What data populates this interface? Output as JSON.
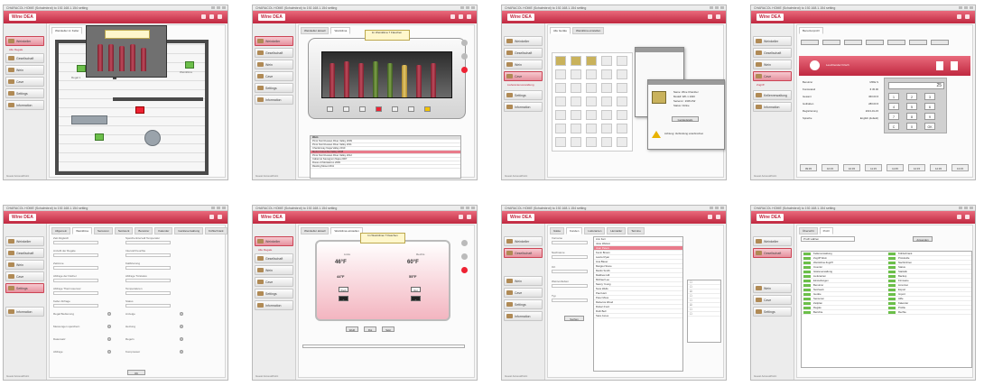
{
  "app": {
    "window_title": "CHARACOL HOME (Schalmbrot) to 192.168.1.154 setting",
    "logo": "Wine DEA",
    "footer": "Guest\nAccessPoint"
  },
  "sidebar_labels": [
    "Weinkeller",
    "Gesellschaft",
    "Wein",
    "Cave",
    "Settings",
    "Kellerverwaltung",
    "Information"
  ],
  "sidebar_sub": [
    "Alle Regale",
    "Lieferantenverwaltung",
    "Zugriff"
  ],
  "shots": [
    {
      "name": "floor-plan",
      "tab": "Weinkeller im Keller",
      "labels": [
        "Kühlschrank A",
        "Regal 1",
        "Regal 2",
        "Weinklima",
        "Tür"
      ]
    },
    {
      "name": "wine-rack",
      "tabs": [
        "Weinkeller aktuell",
        "Weinklima"
      ],
      "status": "Im Weinklima\n7 Flaschen",
      "table_headers": [
        "Wein",
        "Jahr",
        "Platz",
        "Zustand"
      ],
      "rows": [
        "Pinot Noir Russian River Valley 2009",
        "Pinot Noir Russian River Valley 2011",
        "Chardonnay Napa Valley 2010",
        "Merlot Columbia Valley 2008",
        "Pinot Noir Russian River Valley 2012",
        "Cabernet Sauvignon Napa 2007",
        "Rosso di Montalcino 2009",
        "Riesling Mosel 2011"
      ]
    },
    {
      "name": "device-overview",
      "tabs": [
        "Alle Geräte",
        "Weinklima einstellen"
      ],
      "dialog_title": "Gerätedetails",
      "dialog_fields": [
        "Name: Wine Chamber",
        "Modell: WK-1 1020",
        "Seriennr.: 2345-FW",
        "Status: Online"
      ],
      "alert": "Achtung: Verbindung unterbrochen"
    },
    {
      "name": "user-profile",
      "tab": "Benutzerprofil",
      "user": "Leuchtender Frisch",
      "pin_display": "25",
      "fields": [
        "Benutzer",
        "Kontostand",
        "Gesamt",
        "Guthaben",
        "Registrierung",
        "Sprache"
      ],
      "values": [
        "MIKE S",
        "€ 45.00",
        "360.00 €",
        "280.00 €",
        "2013-01-15",
        "English (default)"
      ],
      "time_buttons": [
        "09:45",
        "10:15",
        "10:45",
        "11:15",
        "11:45",
        "12:15",
        "12:45",
        "13:15"
      ]
    },
    {
      "name": "settings-form",
      "tabs": [
        "Allgemein",
        "Weinklima",
        "Sensoren",
        "Netzwerk",
        "Benutzer",
        "Kalender",
        "Geräteverwaltung",
        "Kühlschrank"
      ],
      "left_labels": [
        "Zeit Abgleich",
        "Anzahl der Regale",
        "Zeitzone",
        "Abfrage der Fächer",
        "Abfrage Thermosensor",
        "Keller Abfrage",
        "Regal Bedienung",
        "Messungen speichern",
        "Datensatz",
        "Abfrage"
      ],
      "right_labels": [
        "Speicherintervall Temperatur",
        "Intervall Feuchte",
        "Kalibrierung",
        "Abfrage Türstatus",
        "Temperaturen",
        "Status",
        "Anzeige",
        "Heizung",
        "Regeln",
        "Kompressor"
      ]
    },
    {
      "name": "thermostat",
      "tabs": [
        "Weinkeller aktuell",
        "Weinklima einstellen"
      ],
      "status": "Im Weinklima\n7 Flaschen",
      "left_title": "Links",
      "right_title": "Rechts",
      "left_temp": "46°F",
      "right_temp": "60°F",
      "left_set": "44°F",
      "right_set": "55°F",
      "modes": [
        "Weiß",
        "Rot",
        "Sekt"
      ]
    },
    {
      "name": "customer-list",
      "tabs": [
        "Gäste",
        "Kunden",
        "Lieferanten",
        "Hersteller",
        "Termine"
      ],
      "search_labels": [
        "Vorname",
        "Nachname",
        "Ort",
        "Weinvorlieben",
        "Typ"
      ],
      "btn": "Suchen",
      "rows": [
        "Ann Kerr",
        "Jane Watson",
        "Juan Peters",
        "Kevin Brown",
        "Laurie Ryan",
        "Lisa Bauer",
        "Margret Stone",
        "Martin Smith",
        "Matthew Hill",
        "Michael Lee",
        "Nancy Young",
        "Nora Wells",
        "Paul Hart",
        "Peter Moss",
        "Rebecca Wood",
        "Robert Ford",
        "Ruth Bell",
        "Sara Jones"
      ]
    },
    {
      "name": "profile-settings",
      "tabs": [
        "Übersicht",
        "Profil"
      ],
      "filter": "Profil wählen",
      "btn": "Anwenden",
      "col_left": [
        "Kellerverwaltung",
        "Zugriff Wein",
        "Weinklima Zugriff",
        "Inventur",
        "Gästeverwaltung",
        "Lieferanten",
        "Einstellungen",
        "Benutzer",
        "Netzwerk",
        "Geräte",
        "Sensoren",
        "Zeitplan",
        "Regale",
        "Berichte"
      ],
      "col_right": [
        "Kühlschrank",
        "Protokolle",
        "Nachrichten",
        "Status",
        "Statistik",
        "Backup",
        "Firmware",
        "Lizenzen",
        "Export",
        "Import",
        "Hilfe",
        "Kalender",
        "Profile",
        "Rechte"
      ]
    }
  ]
}
